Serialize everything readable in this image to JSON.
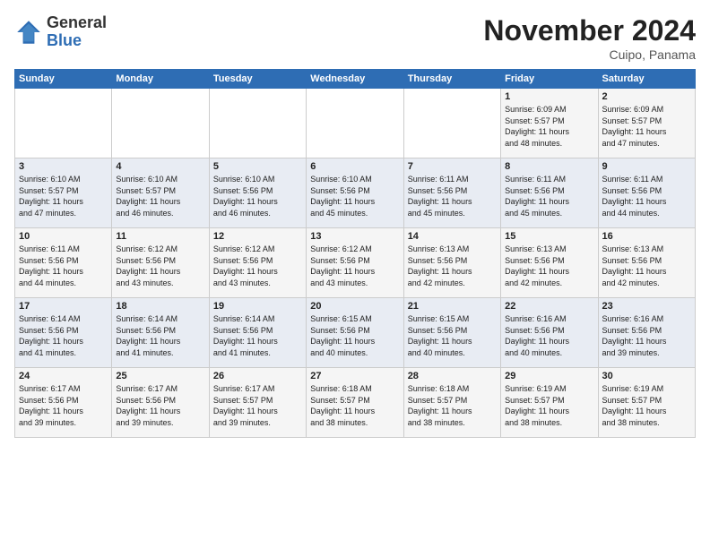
{
  "header": {
    "title": "November 2024",
    "location": "Cuipo, Panama",
    "logo_general": "General",
    "logo_blue": "Blue"
  },
  "days_of_week": [
    "Sunday",
    "Monday",
    "Tuesday",
    "Wednesday",
    "Thursday",
    "Friday",
    "Saturday"
  ],
  "weeks": [
    [
      {
        "day": "",
        "info": ""
      },
      {
        "day": "",
        "info": ""
      },
      {
        "day": "",
        "info": ""
      },
      {
        "day": "",
        "info": ""
      },
      {
        "day": "",
        "info": ""
      },
      {
        "day": "1",
        "info": "Sunrise: 6:09 AM\nSunset: 5:57 PM\nDaylight: 11 hours\nand 48 minutes."
      },
      {
        "day": "2",
        "info": "Sunrise: 6:09 AM\nSunset: 5:57 PM\nDaylight: 11 hours\nand 47 minutes."
      }
    ],
    [
      {
        "day": "3",
        "info": "Sunrise: 6:10 AM\nSunset: 5:57 PM\nDaylight: 11 hours\nand 47 minutes."
      },
      {
        "day": "4",
        "info": "Sunrise: 6:10 AM\nSunset: 5:57 PM\nDaylight: 11 hours\nand 46 minutes."
      },
      {
        "day": "5",
        "info": "Sunrise: 6:10 AM\nSunset: 5:56 PM\nDaylight: 11 hours\nand 46 minutes."
      },
      {
        "day": "6",
        "info": "Sunrise: 6:10 AM\nSunset: 5:56 PM\nDaylight: 11 hours\nand 45 minutes."
      },
      {
        "day": "7",
        "info": "Sunrise: 6:11 AM\nSunset: 5:56 PM\nDaylight: 11 hours\nand 45 minutes."
      },
      {
        "day": "8",
        "info": "Sunrise: 6:11 AM\nSunset: 5:56 PM\nDaylight: 11 hours\nand 45 minutes."
      },
      {
        "day": "9",
        "info": "Sunrise: 6:11 AM\nSunset: 5:56 PM\nDaylight: 11 hours\nand 44 minutes."
      }
    ],
    [
      {
        "day": "10",
        "info": "Sunrise: 6:11 AM\nSunset: 5:56 PM\nDaylight: 11 hours\nand 44 minutes."
      },
      {
        "day": "11",
        "info": "Sunrise: 6:12 AM\nSunset: 5:56 PM\nDaylight: 11 hours\nand 43 minutes."
      },
      {
        "day": "12",
        "info": "Sunrise: 6:12 AM\nSunset: 5:56 PM\nDaylight: 11 hours\nand 43 minutes."
      },
      {
        "day": "13",
        "info": "Sunrise: 6:12 AM\nSunset: 5:56 PM\nDaylight: 11 hours\nand 43 minutes."
      },
      {
        "day": "14",
        "info": "Sunrise: 6:13 AM\nSunset: 5:56 PM\nDaylight: 11 hours\nand 42 minutes."
      },
      {
        "day": "15",
        "info": "Sunrise: 6:13 AM\nSunset: 5:56 PM\nDaylight: 11 hours\nand 42 minutes."
      },
      {
        "day": "16",
        "info": "Sunrise: 6:13 AM\nSunset: 5:56 PM\nDaylight: 11 hours\nand 42 minutes."
      }
    ],
    [
      {
        "day": "17",
        "info": "Sunrise: 6:14 AM\nSunset: 5:56 PM\nDaylight: 11 hours\nand 41 minutes."
      },
      {
        "day": "18",
        "info": "Sunrise: 6:14 AM\nSunset: 5:56 PM\nDaylight: 11 hours\nand 41 minutes."
      },
      {
        "day": "19",
        "info": "Sunrise: 6:14 AM\nSunset: 5:56 PM\nDaylight: 11 hours\nand 41 minutes."
      },
      {
        "day": "20",
        "info": "Sunrise: 6:15 AM\nSunset: 5:56 PM\nDaylight: 11 hours\nand 40 minutes."
      },
      {
        "day": "21",
        "info": "Sunrise: 6:15 AM\nSunset: 5:56 PM\nDaylight: 11 hours\nand 40 minutes."
      },
      {
        "day": "22",
        "info": "Sunrise: 6:16 AM\nSunset: 5:56 PM\nDaylight: 11 hours\nand 40 minutes."
      },
      {
        "day": "23",
        "info": "Sunrise: 6:16 AM\nSunset: 5:56 PM\nDaylight: 11 hours\nand 39 minutes."
      }
    ],
    [
      {
        "day": "24",
        "info": "Sunrise: 6:17 AM\nSunset: 5:56 PM\nDaylight: 11 hours\nand 39 minutes."
      },
      {
        "day": "25",
        "info": "Sunrise: 6:17 AM\nSunset: 5:56 PM\nDaylight: 11 hours\nand 39 minutes."
      },
      {
        "day": "26",
        "info": "Sunrise: 6:17 AM\nSunset: 5:57 PM\nDaylight: 11 hours\nand 39 minutes."
      },
      {
        "day": "27",
        "info": "Sunrise: 6:18 AM\nSunset: 5:57 PM\nDaylight: 11 hours\nand 38 minutes."
      },
      {
        "day": "28",
        "info": "Sunrise: 6:18 AM\nSunset: 5:57 PM\nDaylight: 11 hours\nand 38 minutes."
      },
      {
        "day": "29",
        "info": "Sunrise: 6:19 AM\nSunset: 5:57 PM\nDaylight: 11 hours\nand 38 minutes."
      },
      {
        "day": "30",
        "info": "Sunrise: 6:19 AM\nSunset: 5:57 PM\nDaylight: 11 hours\nand 38 minutes."
      }
    ]
  ]
}
